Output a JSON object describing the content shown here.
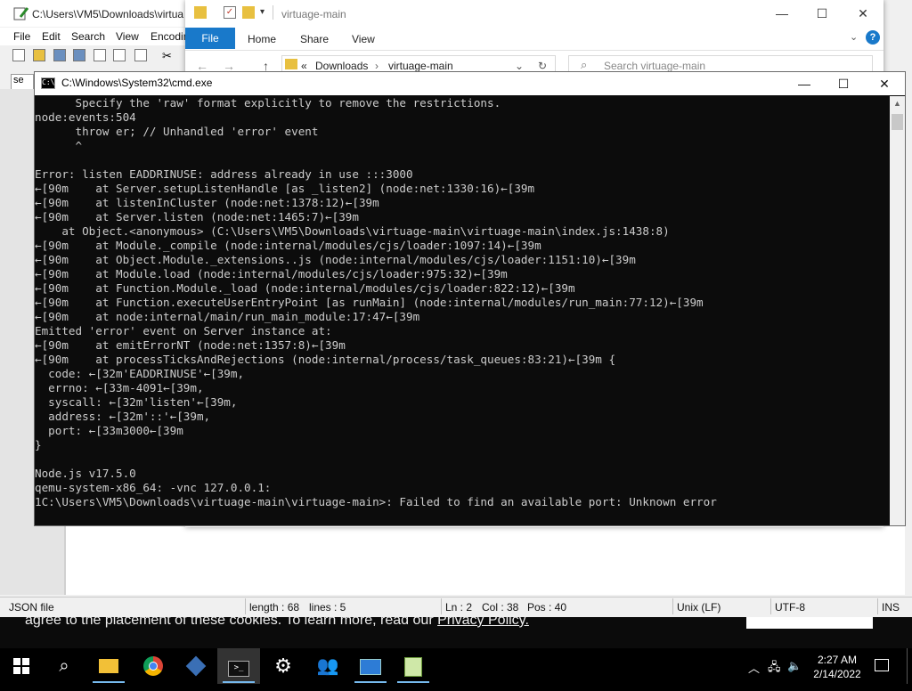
{
  "webpage": {
    "cookie_text": "agree to the placement of these cookies. To learn more, read our",
    "cookie_link": "Privacy Policy."
  },
  "notepad": {
    "title": "C:\\Users\\VM5\\Downloads\\virtua",
    "menu": [
      "File",
      "Edit",
      "Search",
      "View",
      "Encodin"
    ],
    "tab_label": "se",
    "status": {
      "file_type": "JSON file",
      "length": "length : 68",
      "lines": "lines : 5",
      "ln": "Ln : 2",
      "col": "Col : 38",
      "pos": "Pos : 40",
      "eol": "Unix (LF)",
      "encoding": "UTF-8",
      "mode": "INS"
    }
  },
  "explorer": {
    "title": "virtuage-main",
    "tabs": [
      "File",
      "Home",
      "Share",
      "View"
    ],
    "breadcrumb": [
      "Downloads",
      "virtuage-main"
    ],
    "search_placeholder": "Search virtuage-main"
  },
  "cmd": {
    "title": "C:\\Windows\\System32\\cmd.exe",
    "lines": [
      "      Specify the 'raw' format explicitly to remove the restrictions.",
      "node:events:504",
      "      throw er; // Unhandled 'error' event",
      "      ^",
      "",
      "Error: listen EADDRINUSE: address already in use :::3000",
      "←[90m    at Server.setupListenHandle [as _listen2] (node:net:1330:16)←[39m",
      "←[90m    at listenInCluster (node:net:1378:12)←[39m",
      "←[90m    at Server.listen (node:net:1465:7)←[39m",
      "    at Object.<anonymous> (C:\\Users\\VM5\\Downloads\\virtuage-main\\virtuage-main\\index.js:1438:8)",
      "←[90m    at Module._compile (node:internal/modules/cjs/loader:1097:14)←[39m",
      "←[90m    at Object.Module._extensions..js (node:internal/modules/cjs/loader:1151:10)←[39m",
      "←[90m    at Module.load (node:internal/modules/cjs/loader:975:32)←[39m",
      "←[90m    at Function.Module._load (node:internal/modules/cjs/loader:822:12)←[39m",
      "←[90m    at Function.executeUserEntryPoint [as runMain] (node:internal/modules/run_main:77:12)←[39m",
      "←[90m    at node:internal/main/run_main_module:17:47←[39m",
      "Emitted 'error' event on Server instance at:",
      "←[90m    at emitErrorNT (node:net:1357:8)←[39m",
      "←[90m    at processTicksAndRejections (node:internal/process/task_queues:83:21)←[39m {",
      "  code: ←[32m'EADDRINUSE'←[39m,",
      "  errno: ←[33m-4091←[39m,",
      "  syscall: ←[32m'listen'←[39m,",
      "  address: ←[32m'::'←[39m,",
      "  port: ←[33m3000←[39m",
      "}",
      "",
      "Node.js v17.5.0",
      "qemu-system-x86_64: -vnc 127.0.0.1:",
      "1C:\\Users\\VM5\\Downloads\\virtuage-main\\virtuage-main>: Failed to find an available port: Unknown error"
    ]
  },
  "taskbar": {
    "apps": [
      "start-icon",
      "search-icon",
      "file-explorer-icon",
      "chrome-icon",
      "virtualbox-icon",
      "cmd-icon",
      "settings-icon",
      "people-icon",
      "network-icon",
      "notepad-plus-plus-icon"
    ],
    "time": "2:27 AM",
    "date": "2/14/2022"
  }
}
